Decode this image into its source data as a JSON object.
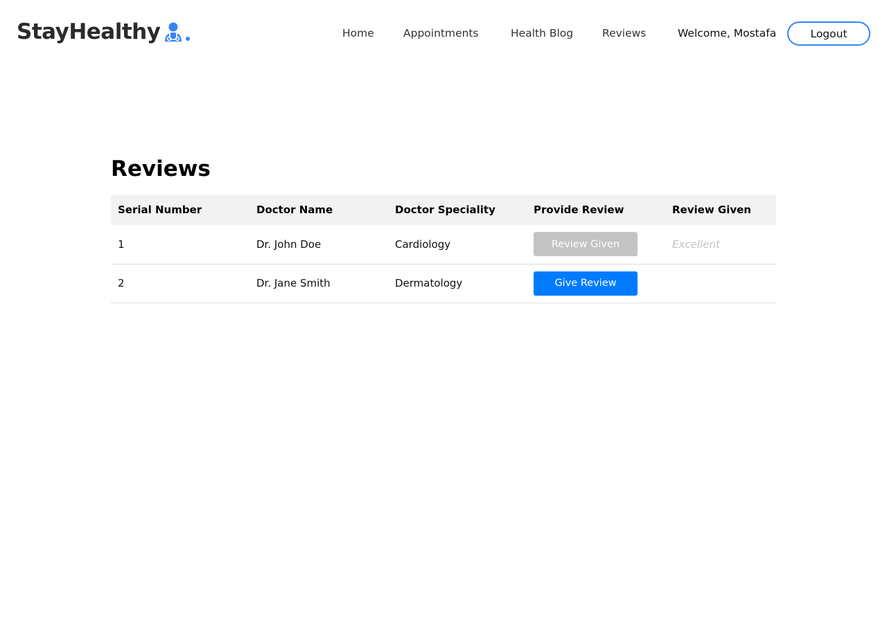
{
  "header": {
    "brand": "StayHealthy",
    "brand_icon": "doctor-icon",
    "accent_color": "#3685fb",
    "nav": {
      "home": "Home",
      "appointments": "Appointments",
      "health_blog": "Health Blog",
      "reviews": "Reviews"
    },
    "welcome": "Welcome, Mostafa",
    "logout_label": "Logout"
  },
  "main": {
    "title": "Reviews",
    "columns": {
      "serial": "Serial Number",
      "doctor_name": "Doctor Name",
      "speciality": "Doctor Speciality",
      "provide_review": "Provide Review",
      "review_given": "Review Given"
    },
    "rows": [
      {
        "serial": "1",
        "doctor_name": "Dr. John Doe",
        "speciality": "Cardiology",
        "button_label": "Review Given",
        "button_disabled": true,
        "review": "Excellent"
      },
      {
        "serial": "2",
        "doctor_name": "Dr. Jane Smith",
        "speciality": "Dermatology",
        "button_label": "Give Review",
        "button_disabled": false,
        "review": ""
      }
    ],
    "button_color_active": "#007bff",
    "button_color_disabled": "#c3c3c3"
  }
}
